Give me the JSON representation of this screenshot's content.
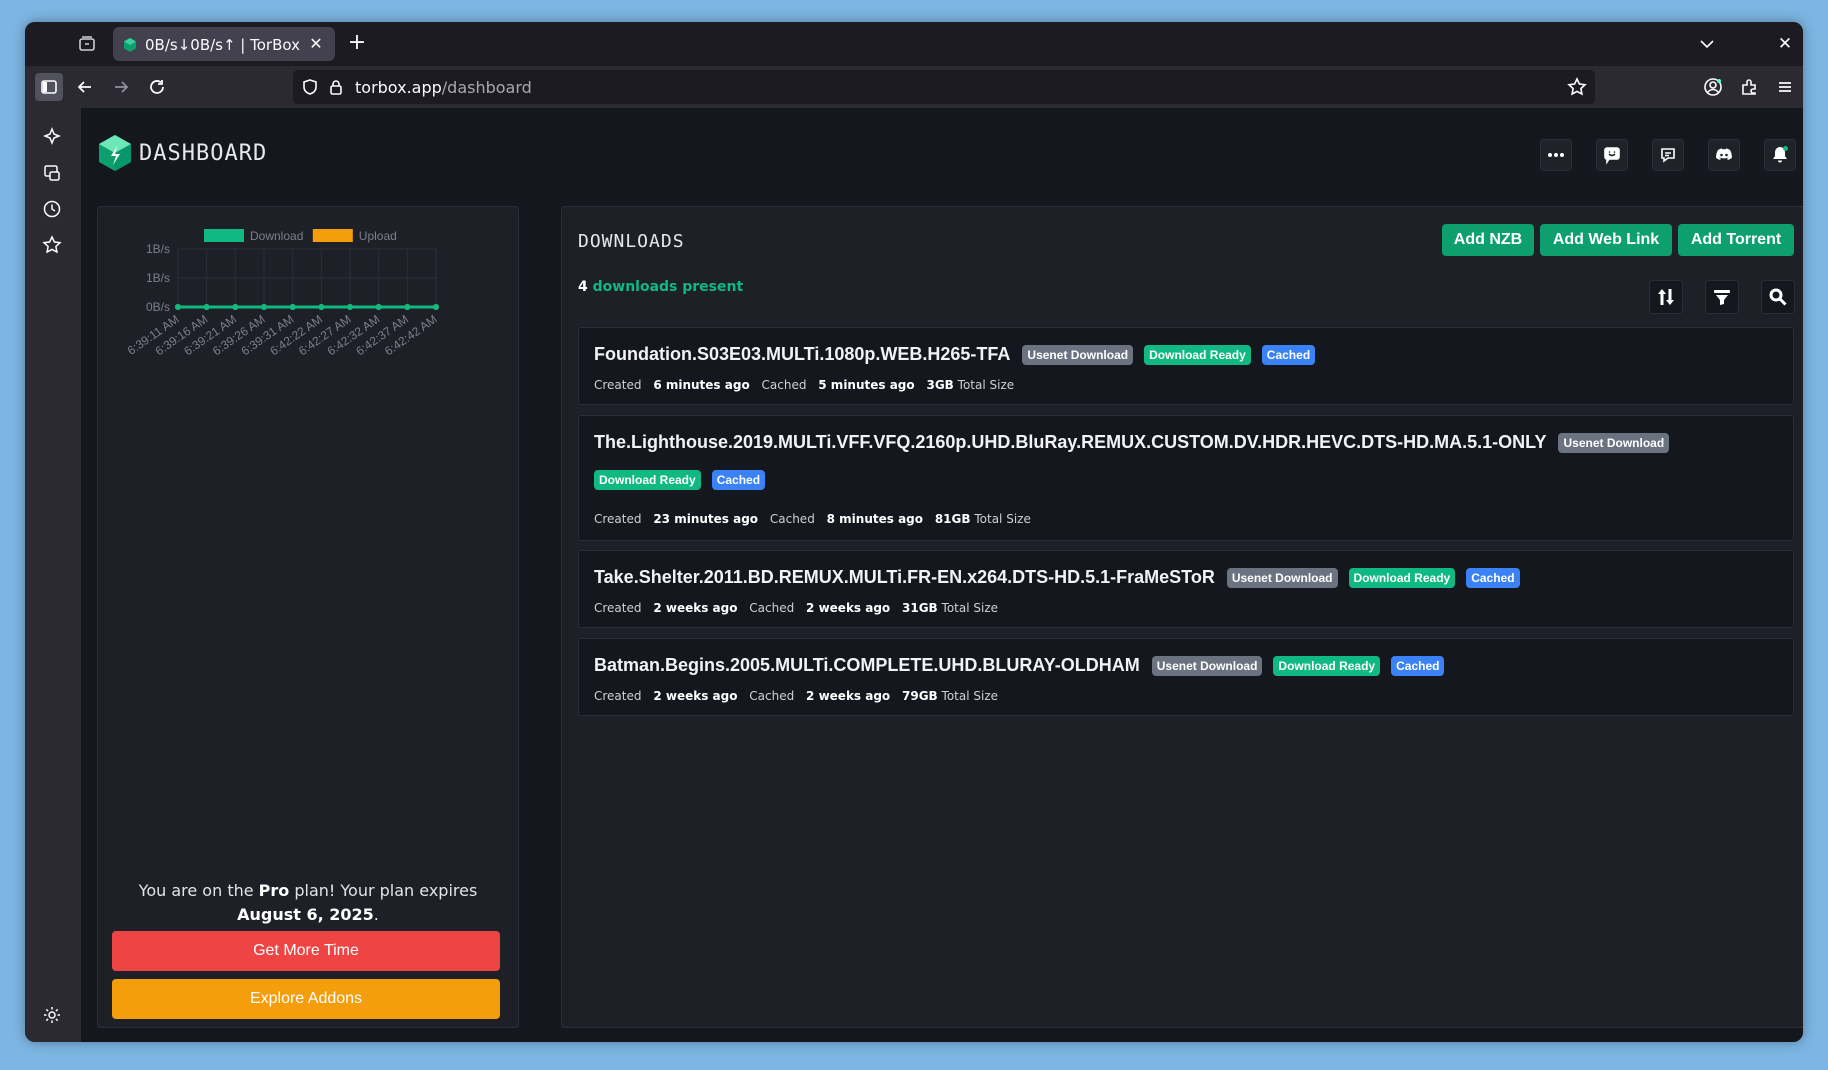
{
  "browser": {
    "tab_title": "0B/s↓0B/s↑ | TorBox",
    "url_host": "torbox.app",
    "url_path": "/dashboard"
  },
  "header": {
    "title": "DASHBOARD"
  },
  "chart_data": {
    "type": "line",
    "legend": [
      "Download",
      "Upload"
    ],
    "legend_position": "top",
    "y_ticks": [
      "1B/s",
      "1B/s",
      "0B/s"
    ],
    "x": [
      "6:39:11 AM",
      "6:39:16 AM",
      "6:39:21 AM",
      "6:39:26 AM",
      "6:39:31 AM",
      "6:42:22 AM",
      "6:42:27 AM",
      "6:42:32 AM",
      "6:42:37 AM",
      "6:42:42 AM"
    ],
    "series": [
      {
        "name": "Download",
        "color": "#10b981",
        "values": [
          0,
          0,
          0,
          0,
          0,
          0,
          0,
          0,
          0,
          0
        ]
      },
      {
        "name": "Upload",
        "color": "#f59e0b",
        "values": [
          0,
          0,
          0,
          0,
          0,
          0,
          0,
          0,
          0,
          0
        ]
      }
    ],
    "grid": true
  },
  "plan": {
    "prefix": "You are on the ",
    "plan_name": "Pro",
    "middle": " plan! Your plan expires ",
    "expiry": "August 6, 2025",
    "suffix": ".",
    "more_time_label": "Get More Time",
    "addons_label": "Explore Addons"
  },
  "downloads": {
    "title": "DOWNLOADS",
    "add_nzb": "Add NZB",
    "add_web_link": "Add Web Link",
    "add_torrent": "Add Torrent",
    "count": "4",
    "count_label": "downloads present",
    "items": [
      {
        "name": "Foundation.S03E03.MULTi.1080p.WEB.H265-TFA",
        "badges": [
          "Usenet Download",
          "Download Ready",
          "Cached"
        ],
        "created": "6 minutes ago",
        "cached": "5 minutes ago",
        "size": "3GB"
      },
      {
        "name": "The.Lighthouse.2019.MULTi.VFF.VFQ.2160p.UHD.BluRay.REMUX.CUSTOM.DV.HDR.HEVC.DTS-HD.MA.5.1-ONLY",
        "badges": [
          "Usenet Download",
          "Download Ready",
          "Cached"
        ],
        "created": "23 minutes ago",
        "cached": "8 minutes ago",
        "size": "81GB"
      },
      {
        "name": "Take.Shelter.2011.BD.REMUX.MULTi.FR-EN.x264.DTS-HD.5.1-FraMeSToR",
        "badges": [
          "Usenet Download",
          "Download Ready",
          "Cached"
        ],
        "created": "2 weeks ago",
        "cached": "2 weeks ago",
        "size": "31GB"
      },
      {
        "name": "Batman.Begins.2005.MULTi.COMPLETE.UHD.BLURAY-OLDHAM",
        "badges": [
          "Usenet Download",
          "Download Ready",
          "Cached"
        ],
        "created": "2 weeks ago",
        "cached": "2 weeks ago",
        "size": "79GB"
      }
    ],
    "created_label": "Created",
    "cached_label": "Cached",
    "size_label": "Total Size"
  }
}
